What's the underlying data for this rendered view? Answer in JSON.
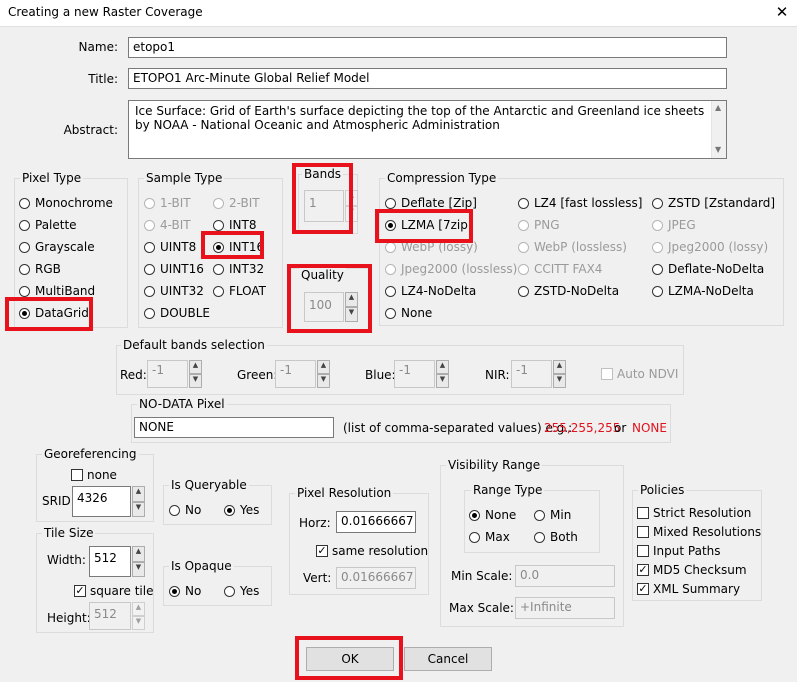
{
  "window": {
    "title": "Creating a new Raster Coverage",
    "close_glyph": "✕"
  },
  "form": {
    "name_label": "Name:",
    "name_value": "etopo1",
    "title_label": "Title:",
    "title_value": "ETOPO1 Arc-Minute Global Relief Model",
    "abstract_label": "Abstract:",
    "abstract_line1": "Ice Surface: Grid of Earth's surface depicting the top of the Antarctic and Greenland ice sheets",
    "abstract_line2": "by NOAA - National Oceanic and Atmospheric Administration"
  },
  "pixel_type": {
    "title": "Pixel Type",
    "options": [
      "Monochrome",
      "Palette",
      "Grayscale",
      "RGB",
      "MultiBand",
      "DataGrid"
    ],
    "selected": "DataGrid"
  },
  "sample_type": {
    "title": "Sample Type",
    "options": [
      "1-BIT",
      "2-BIT",
      "4-BIT",
      "INT8",
      "UINT8",
      "INT16",
      "UINT16",
      "INT32",
      "UINT32",
      "FLOAT",
      "DOUBLE"
    ],
    "selected": "INT16"
  },
  "bands": {
    "title": "Bands",
    "value": "1"
  },
  "quality": {
    "title": "Quality",
    "value": "100"
  },
  "compression": {
    "title": "Compression Type",
    "options": [
      "Deflate [Zip]",
      "LZ4 [fast lossless]",
      "ZSTD [Zstandard]",
      "LZMA [7zip]",
      "PNG",
      "JPEG",
      "WebP (lossy)",
      "WebP (lossless)",
      "Jpeg2000 (lossy)",
      "Jpeg2000 (lossless)",
      "CCITT FAX4",
      "Deflate-NoDelta",
      "LZ4-NoDelta",
      "ZSTD-NoDelta",
      "LZMA-NoDelta",
      "None"
    ],
    "selected": "LZMA [7zip]"
  },
  "default_bands": {
    "title": "Default bands selection",
    "red_label": "Red:",
    "red_value": "-1",
    "green_label": "Green:",
    "green_value": "-1",
    "blue_label": "Blue:",
    "blue_value": "-1",
    "nir_label": "NIR:",
    "nir_value": "-1",
    "auto_ndvi_label": "Auto NDVI"
  },
  "nodata": {
    "title": "NO-DATA Pixel",
    "value": "NONE",
    "hint": "(list of comma-separated values) e.g.:",
    "example": "255,255,255",
    "or_label": "or",
    "none_example": "NONE"
  },
  "georef": {
    "title": "Georeferencing",
    "none_label": "none",
    "srid_label": "SRID:",
    "srid_value": "4326"
  },
  "queryable": {
    "title": "Is Queryable",
    "no_label": "No",
    "yes_label": "Yes",
    "selected": "Yes"
  },
  "opaque": {
    "title": "Is Opaque",
    "no_label": "No",
    "yes_label": "Yes",
    "selected": "No"
  },
  "pixel_resolution": {
    "title": "Pixel Resolution",
    "horz_label": "Horz:",
    "horz_value": "0.01666667",
    "same_label": "same resolution",
    "vert_label": "Vert:",
    "vert_value": "0.01666667"
  },
  "tile_size": {
    "title": "Tile Size",
    "width_label": "Width:",
    "width_value": "512",
    "square_label": "square tile",
    "height_label": "Height:",
    "height_value": "512"
  },
  "visibility": {
    "title": "Visibility Range",
    "range_type_title": "Range Type",
    "none_label": "None",
    "min_label": "Min",
    "max_label": "Max",
    "both_label": "Both",
    "selected": "None",
    "min_scale_label": "Min Scale:",
    "min_scale_value": "0.0",
    "max_scale_label": "Max Scale:",
    "max_scale_value": "+Infinite"
  },
  "policies": {
    "title": "Policies",
    "items": [
      "Strict Resolution",
      "Mixed Resolutions",
      "Input Paths",
      "MD5 Checksum",
      "XML Summary"
    ]
  },
  "buttons": {
    "ok": "OK",
    "cancel": "Cancel"
  }
}
